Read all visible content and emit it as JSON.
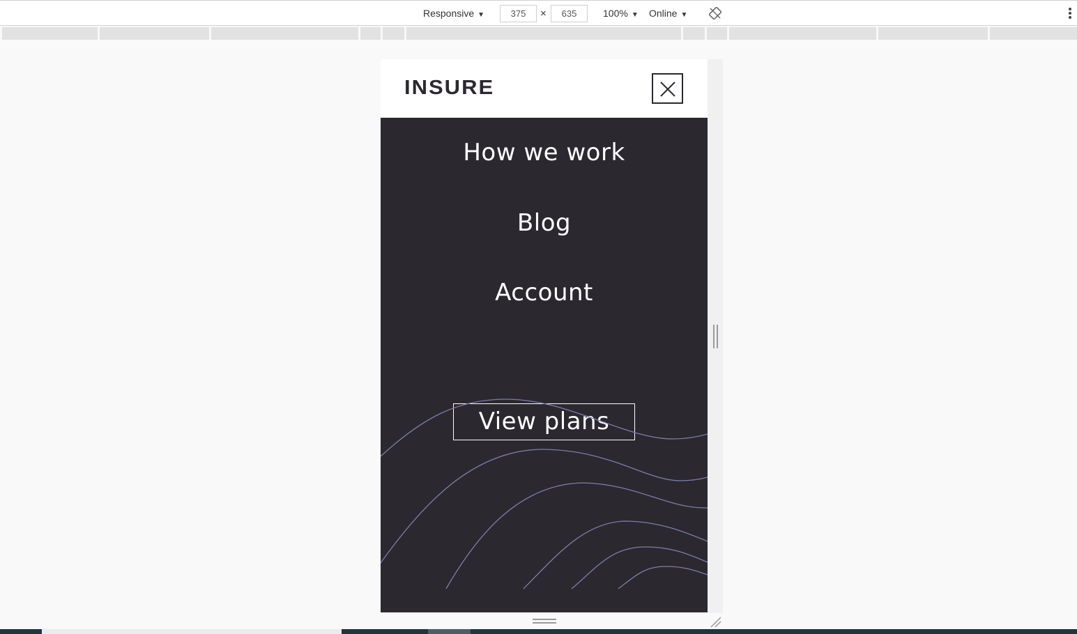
{
  "devtools": {
    "device_mode": "Responsive",
    "width": "375",
    "times": "×",
    "height": "635",
    "zoom": "100%",
    "network": "Online",
    "rotate_icon": "rotate-icon",
    "more_icon": "vertical-ellipsis-icon"
  },
  "site": {
    "logo": "INSURE",
    "close_icon": "close-icon",
    "nav": {
      "items": [
        "How we work",
        "Blog",
        "Account"
      ],
      "cta": "View plans"
    },
    "colors": {
      "menu_bg": "#2c2830",
      "header_bg": "#ffffff",
      "wave_stroke": "#7a7fa8"
    }
  }
}
